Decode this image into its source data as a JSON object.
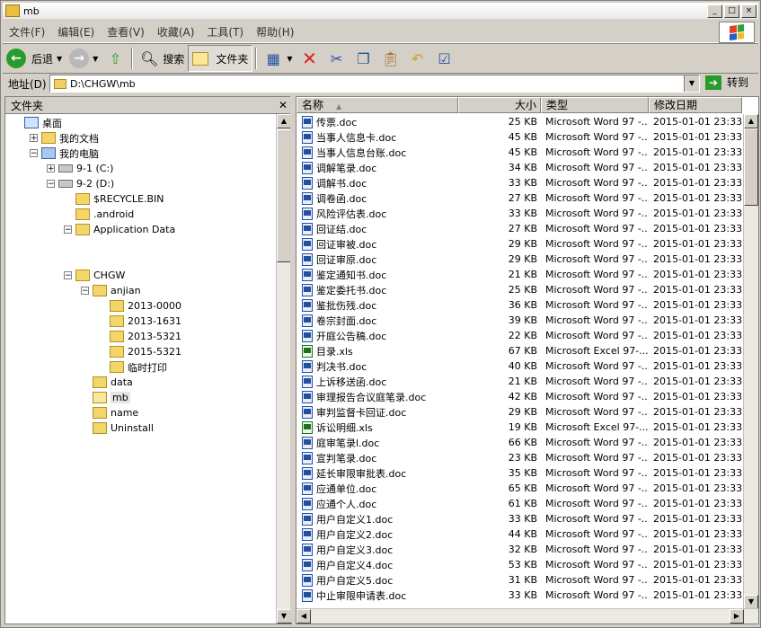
{
  "window": {
    "title": "mb"
  },
  "menu": [
    "文件(F)",
    "编辑(E)",
    "查看(V)",
    "收藏(A)",
    "工具(T)",
    "帮助(H)"
  ],
  "toolbar": {
    "back": "后退",
    "search": "搜索",
    "folders": "文件夹"
  },
  "address": {
    "label": "地址(D)",
    "path": "D:\\CHGW\\mb",
    "go": "转到"
  },
  "folder_pane": {
    "title": "文件夹"
  },
  "tree": [
    {
      "label": "桌面",
      "indent": 0,
      "exp": "",
      "kind": "desktop"
    },
    {
      "label": "我的文档",
      "indent": 1,
      "exp": "+",
      "kind": "docs"
    },
    {
      "label": "我的电脑",
      "indent": 1,
      "exp": "−",
      "kind": "pc"
    },
    {
      "label": "9-1 (C:)",
      "indent": 2,
      "exp": "+",
      "kind": "drive"
    },
    {
      "label": "9-2 (D:)",
      "indent": 2,
      "exp": "−",
      "kind": "drive"
    },
    {
      "label": "$RECYCLE.BIN",
      "indent": 3,
      "exp": "",
      "kind": "folder"
    },
    {
      "label": ".android",
      "indent": 3,
      "exp": "",
      "kind": "folder"
    },
    {
      "label": "Application Data",
      "indent": 3,
      "exp": "−",
      "kind": "folder"
    },
    {
      "label": "",
      "indent": 4,
      "exp": "",
      "kind": "blank"
    },
    {
      "label": "",
      "indent": 4,
      "exp": "",
      "kind": "blank"
    },
    {
      "label": "CHGW",
      "indent": 3,
      "exp": "−",
      "kind": "folder"
    },
    {
      "label": "anjian",
      "indent": 4,
      "exp": "−",
      "kind": "folder"
    },
    {
      "label": "2013-0000",
      "indent": 5,
      "exp": "",
      "kind": "folder"
    },
    {
      "label": "2013-1631",
      "indent": 5,
      "exp": "",
      "kind": "folder"
    },
    {
      "label": "2013-5321",
      "indent": 5,
      "exp": "",
      "kind": "folder"
    },
    {
      "label": "2015-5321",
      "indent": 5,
      "exp": "",
      "kind": "folder"
    },
    {
      "label": "临时打印",
      "indent": 5,
      "exp": "",
      "kind": "folder"
    },
    {
      "label": "data",
      "indent": 4,
      "exp": "",
      "kind": "folder"
    },
    {
      "label": "mb",
      "indent": 4,
      "exp": "",
      "kind": "folder-open",
      "selected": true
    },
    {
      "label": "name",
      "indent": 4,
      "exp": "",
      "kind": "folder"
    },
    {
      "label": "Uninstall",
      "indent": 4,
      "exp": "",
      "kind": "folder"
    }
  ],
  "columns": {
    "name": "名称",
    "size": "大小",
    "type": "类型",
    "date": "修改日期"
  },
  "files": [
    {
      "name": "传票.doc",
      "size": "25 KB",
      "type": "Microsoft Word 97 -...",
      "date": "2015-01-01 23:33",
      "ext": "doc"
    },
    {
      "name": "当事人信息卡.doc",
      "size": "45 KB",
      "type": "Microsoft Word 97 -...",
      "date": "2015-01-01 23:33",
      "ext": "doc"
    },
    {
      "name": "当事人信息台账.doc",
      "size": "45 KB",
      "type": "Microsoft Word 97 -...",
      "date": "2015-01-01 23:33",
      "ext": "doc"
    },
    {
      "name": "调解笔录.doc",
      "size": "34 KB",
      "type": "Microsoft Word 97 -...",
      "date": "2015-01-01 23:33",
      "ext": "doc"
    },
    {
      "name": "调解书.doc",
      "size": "33 KB",
      "type": "Microsoft Word 97 -...",
      "date": "2015-01-01 23:33",
      "ext": "doc"
    },
    {
      "name": "调卷函.doc",
      "size": "27 KB",
      "type": "Microsoft Word 97 -...",
      "date": "2015-01-01 23:33",
      "ext": "doc"
    },
    {
      "name": "风险评估表.doc",
      "size": "33 KB",
      "type": "Microsoft Word 97 -...",
      "date": "2015-01-01 23:33",
      "ext": "doc"
    },
    {
      "name": "回证结.doc",
      "size": "27 KB",
      "type": "Microsoft Word 97 -...",
      "date": "2015-01-01 23:33",
      "ext": "doc"
    },
    {
      "name": "回证审被.doc",
      "size": "29 KB",
      "type": "Microsoft Word 97 -...",
      "date": "2015-01-01 23:33",
      "ext": "doc"
    },
    {
      "name": "回证审原.doc",
      "size": "29 KB",
      "type": "Microsoft Word 97 -...",
      "date": "2015-01-01 23:33",
      "ext": "doc"
    },
    {
      "name": "鉴定通知书.doc",
      "size": "21 KB",
      "type": "Microsoft Word 97 -...",
      "date": "2015-01-01 23:33",
      "ext": "doc"
    },
    {
      "name": "鉴定委托书.doc",
      "size": "25 KB",
      "type": "Microsoft Word 97 -...",
      "date": "2015-01-01 23:33",
      "ext": "doc"
    },
    {
      "name": "鉴批伤残.doc",
      "size": "36 KB",
      "type": "Microsoft Word 97 -...",
      "date": "2015-01-01 23:33",
      "ext": "doc"
    },
    {
      "name": "卷宗封面.doc",
      "size": "39 KB",
      "type": "Microsoft Word 97 -...",
      "date": "2015-01-01 23:33",
      "ext": "doc"
    },
    {
      "name": "开庭公告稿.doc",
      "size": "22 KB",
      "type": "Microsoft Word 97 -...",
      "date": "2015-01-01 23:33",
      "ext": "doc"
    },
    {
      "name": "目录.xls",
      "size": "67 KB",
      "type": "Microsoft Excel 97-...",
      "date": "2015-01-01 23:33",
      "ext": "xls"
    },
    {
      "name": "判决书.doc",
      "size": "40 KB",
      "type": "Microsoft Word 97 -...",
      "date": "2015-01-01 23:33",
      "ext": "doc"
    },
    {
      "name": "上诉移送函.doc",
      "size": "21 KB",
      "type": "Microsoft Word 97 -...",
      "date": "2015-01-01 23:33",
      "ext": "doc"
    },
    {
      "name": "审理报告合议庭笔录.doc",
      "size": "42 KB",
      "type": "Microsoft Word 97 -...",
      "date": "2015-01-01 23:33",
      "ext": "doc"
    },
    {
      "name": "审判监督卡回证.doc",
      "size": "29 KB",
      "type": "Microsoft Word 97 -...",
      "date": "2015-01-01 23:33",
      "ext": "doc"
    },
    {
      "name": "诉讼明细.xls",
      "size": "19 KB",
      "type": "Microsoft Excel 97-...",
      "date": "2015-01-01 23:33",
      "ext": "xls"
    },
    {
      "name": "庭审笔录l.doc",
      "size": "66 KB",
      "type": "Microsoft Word 97 -...",
      "date": "2015-01-01 23:33",
      "ext": "doc"
    },
    {
      "name": "宣判笔录.doc",
      "size": "23 KB",
      "type": "Microsoft Word 97 -...",
      "date": "2015-01-01 23:33",
      "ext": "doc"
    },
    {
      "name": "延长审限审批表.doc",
      "size": "35 KB",
      "type": "Microsoft Word 97 -...",
      "date": "2015-01-01 23:33",
      "ext": "doc"
    },
    {
      "name": "应通单位.doc",
      "size": "65 KB",
      "type": "Microsoft Word 97 -...",
      "date": "2015-01-01 23:33",
      "ext": "doc"
    },
    {
      "name": "应通个人.doc",
      "size": "61 KB",
      "type": "Microsoft Word 97 -...",
      "date": "2015-01-01 23:33",
      "ext": "doc"
    },
    {
      "name": "用户自定义1.doc",
      "size": "33 KB",
      "type": "Microsoft Word 97 -...",
      "date": "2015-01-01 23:33",
      "ext": "doc"
    },
    {
      "name": "用户自定义2.doc",
      "size": "44 KB",
      "type": "Microsoft Word 97 -...",
      "date": "2015-01-01 23:33",
      "ext": "doc"
    },
    {
      "name": "用户自定义3.doc",
      "size": "32 KB",
      "type": "Microsoft Word 97 -...",
      "date": "2015-01-01 23:33",
      "ext": "doc"
    },
    {
      "name": "用户自定义4.doc",
      "size": "53 KB",
      "type": "Microsoft Word 97 -...",
      "date": "2015-01-01 23:33",
      "ext": "doc"
    },
    {
      "name": "用户自定义5.doc",
      "size": "31 KB",
      "type": "Microsoft Word 97 -...",
      "date": "2015-01-01 23:33",
      "ext": "doc"
    },
    {
      "name": "中止审限申请表.doc",
      "size": "33 KB",
      "type": "Microsoft Word 97 -...",
      "date": "2015-01-01 23:33",
      "ext": "doc"
    }
  ]
}
